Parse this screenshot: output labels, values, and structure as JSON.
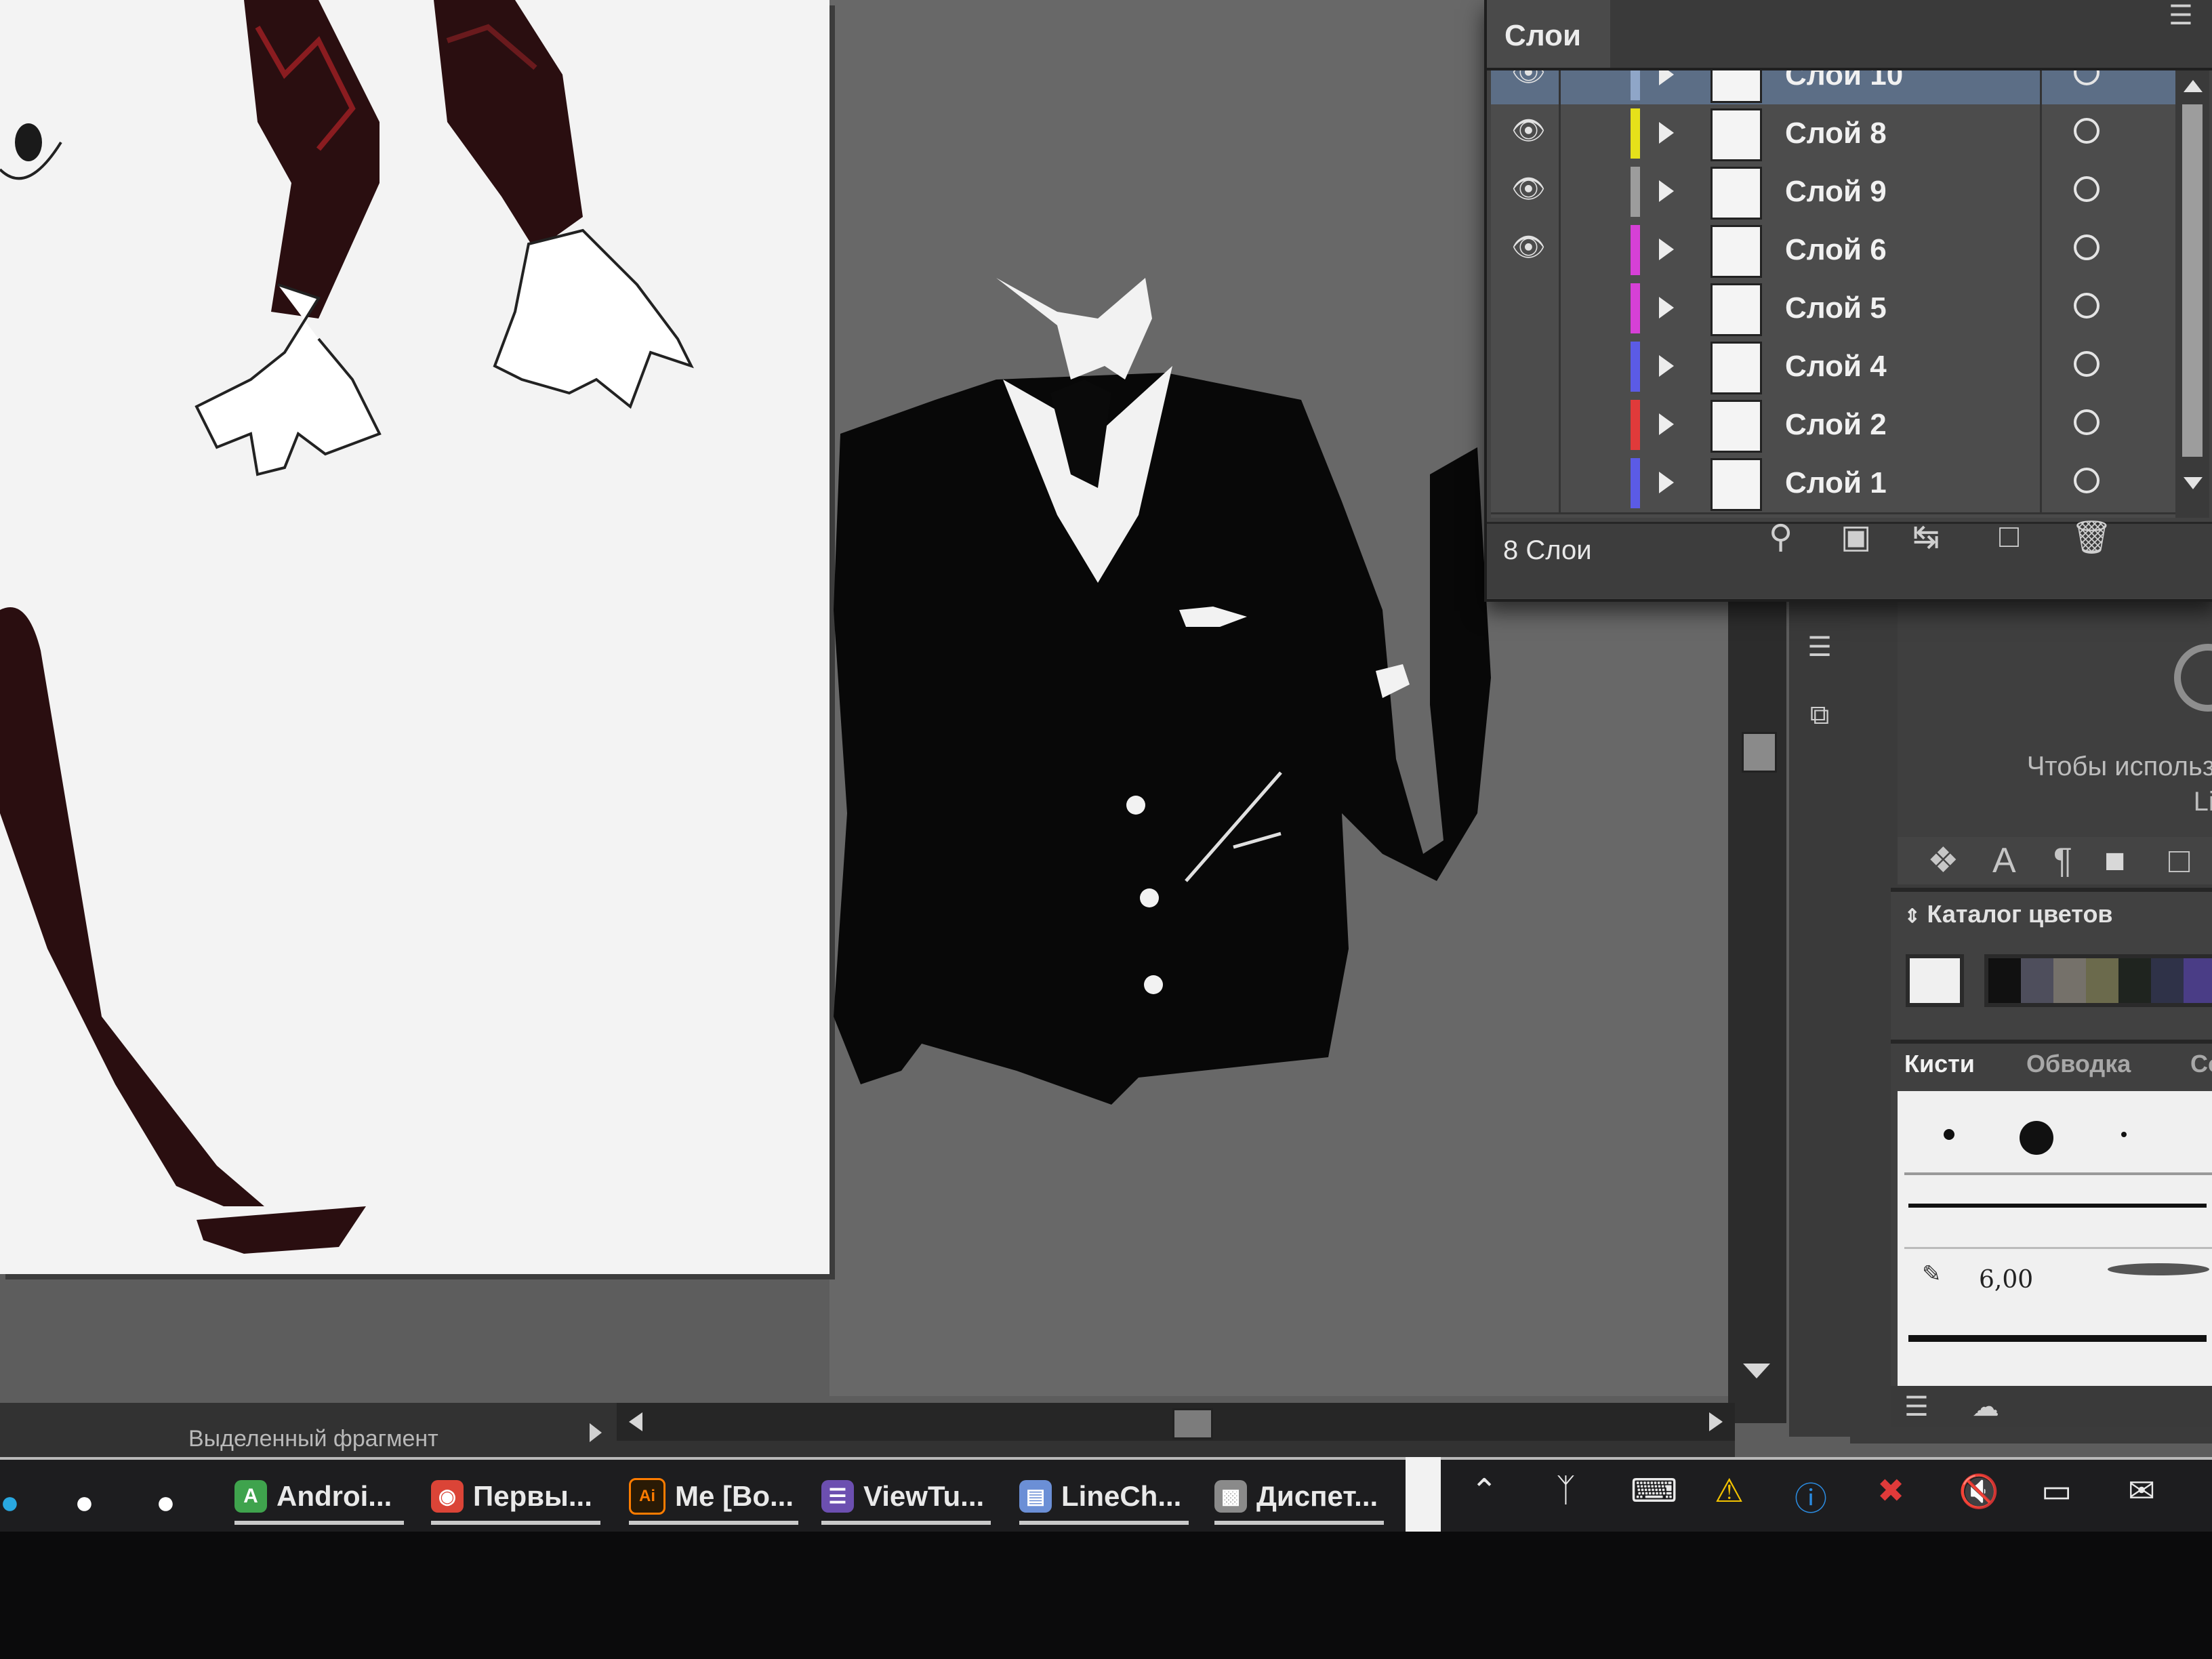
{
  "layers_panel": {
    "title": "Слои",
    "count_label": "8 Слои",
    "layers": [
      {
        "name": "Слой 10",
        "visible": true,
        "color": "#8fa6c8",
        "selected": true
      },
      {
        "name": "Слой 8",
        "visible": true,
        "color": "#e6e01a",
        "selected": false
      },
      {
        "name": "Слой 9",
        "visible": true,
        "color": "#9c9c9c",
        "selected": false
      },
      {
        "name": "Слой 6",
        "visible": true,
        "color": "#d640d6",
        "selected": false
      },
      {
        "name": "Слой 5",
        "visible": false,
        "color": "#d640d6",
        "selected": false
      },
      {
        "name": "Слой 4",
        "visible": false,
        "color": "#5b5be6",
        "selected": false
      },
      {
        "name": "Слой 2",
        "visible": false,
        "color": "#e03a3a",
        "selected": false
      },
      {
        "name": "Слой 1",
        "visible": false,
        "color": "#5b5be6",
        "selected": false
      }
    ],
    "footer_icons": [
      "search-icon",
      "make-clipping-mask-icon",
      "move-to-layer-icon",
      "new-layer-icon",
      "trash-icon"
    ]
  },
  "libraries": {
    "hint_line1": "Чтобы использо",
    "hint_line2": "Lib"
  },
  "swatches": {
    "title": "Каталог цветов",
    "colors": [
      "#111111",
      "#4e4e5c",
      "#75716a",
      "#6b6a4c",
      "#1f241f",
      "#2f3248",
      "#4a3d86"
    ]
  },
  "brushes": {
    "tab_brushes": "Кисти",
    "tab_stroke": "Обводка",
    "tab_more": "Со",
    "size_value": "6,00"
  },
  "status": {
    "selection_label": "Выделенный фрагмент"
  },
  "taskbar": {
    "items": [
      {
        "label": "Androi...",
        "icon": "android-icon",
        "color": "#3fa34d"
      },
      {
        "label": "Первы...",
        "icon": "chrome-icon",
        "color": "#db4437"
      },
      {
        "label": "Me [Bo...",
        "icon": "illustrator-icon",
        "color": "#ff7c00"
      },
      {
        "label": "ViewTu...",
        "icon": "viewtube-icon",
        "color": "#6c4fb0"
      },
      {
        "label": "LineCh...",
        "icon": "linechart-icon",
        "color": "#6b8fd6"
      },
      {
        "label": "Диспет...",
        "icon": "task-manager-icon",
        "color": "#8a8a8a"
      }
    ],
    "pinned_icons": [
      "skype-icon",
      "yandex-icon",
      "edge-icon"
    ],
    "tray_icons": [
      "chevron-up-icon",
      "bluetooth-icon",
      "keyboard-icon",
      "warning-icon",
      "info-icon",
      "network-off-icon",
      "volume-muted-icon",
      "battery-icon",
      "notifications-icon"
    ]
  }
}
